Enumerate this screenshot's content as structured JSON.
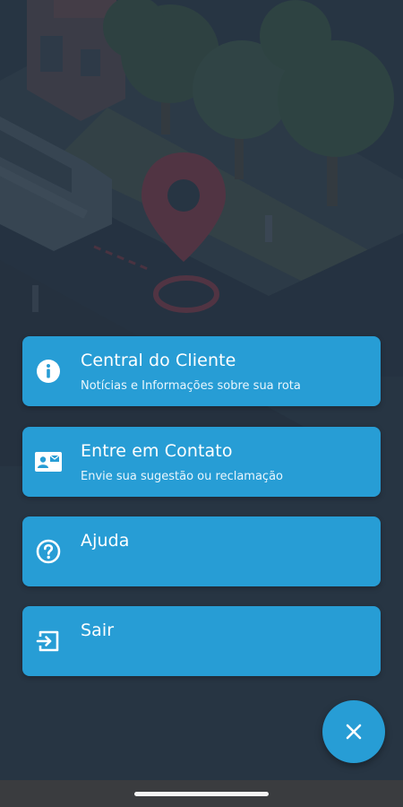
{
  "menu": {
    "items": [
      {
        "icon": "info-icon",
        "title": "Central do Cliente",
        "subtitle": "Notícias e Informações sobre sua rota"
      },
      {
        "icon": "contact-card-icon",
        "title": "Entre em Contato",
        "subtitle": "Envie sua sugestão ou reclamação"
      },
      {
        "icon": "help-circle-icon",
        "title": "Ajuda",
        "subtitle": ""
      },
      {
        "icon": "logout-icon",
        "title": "Sair",
        "subtitle": ""
      }
    ]
  },
  "fab": {
    "icon": "close-icon"
  },
  "colors": {
    "accent": "#279dd5",
    "background": "#2f3e4d",
    "pin": "#8c3d4c",
    "nav_bar": "#3a3c3f"
  },
  "background": {
    "image": "isometric-street-illustration"
  }
}
